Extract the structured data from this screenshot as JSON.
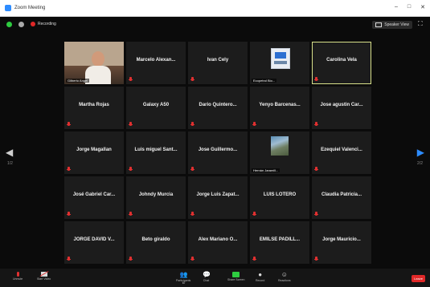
{
  "window": {
    "title": "Zoom Meeting",
    "controls": [
      "–",
      "□",
      "✕"
    ]
  },
  "topbar": {
    "recording_label": "Recording",
    "speaker_view_label": "Speaker View"
  },
  "colors": {
    "active_border": "#d8e08a",
    "mute": "#e03030",
    "share": "#2ecc40",
    "leave": "#e02828",
    "accent": "#2d8cff"
  },
  "participants": [
    {
      "name": "Gilberto Angel",
      "kind": "video"
    },
    {
      "name": "Marcelo Alexan...",
      "kind": "name"
    },
    {
      "name": "Ivan Cely",
      "kind": "name"
    },
    {
      "name": "Ecopetrol Bio...",
      "kind": "image"
    },
    {
      "name": "Carolina Vela",
      "kind": "name",
      "active": true
    },
    {
      "name": "Martha Rojas",
      "kind": "name"
    },
    {
      "name": "Galaxy A50",
      "kind": "name"
    },
    {
      "name": "Dario Quintero...",
      "kind": "name"
    },
    {
      "name": "Yenyo Barcenas...",
      "kind": "name"
    },
    {
      "name": "Jose agustin Car...",
      "kind": "name"
    },
    {
      "name": "Jorge Magallan",
      "kind": "name"
    },
    {
      "name": "Luis miguel Sant...",
      "kind": "name"
    },
    {
      "name": "Jose Guillermo...",
      "kind": "name"
    },
    {
      "name": "Hernán Jaramill...",
      "kind": "map"
    },
    {
      "name": "Ezequiel Valenci...",
      "kind": "name"
    },
    {
      "name": "José Gabriel Car...",
      "kind": "name"
    },
    {
      "name": "Johndy Murcia",
      "kind": "name"
    },
    {
      "name": "Jorge Luis Zapat...",
      "kind": "name"
    },
    {
      "name": "LUIS LOTERO",
      "kind": "name"
    },
    {
      "name": "Claudia Patricia...",
      "kind": "name"
    },
    {
      "name": "JORGE DAVID V...",
      "kind": "name"
    },
    {
      "name": "Beto giraldo",
      "kind": "name"
    },
    {
      "name": "Alex Mariano O...",
      "kind": "name"
    },
    {
      "name": "EMILSE PADILL...",
      "kind": "name"
    },
    {
      "name": "Jorge Mauricio...",
      "kind": "name"
    }
  ],
  "pager": {
    "left": "1/2",
    "right": "2/2"
  },
  "toolbar": {
    "unmute": "Unmute",
    "start_video": "Start Video",
    "participants": "Participants",
    "participants_count": "67",
    "chat": "Chat",
    "share_screen": "Share Screen",
    "record": "Record",
    "reactions": "Reactions",
    "leave": "Leave"
  }
}
